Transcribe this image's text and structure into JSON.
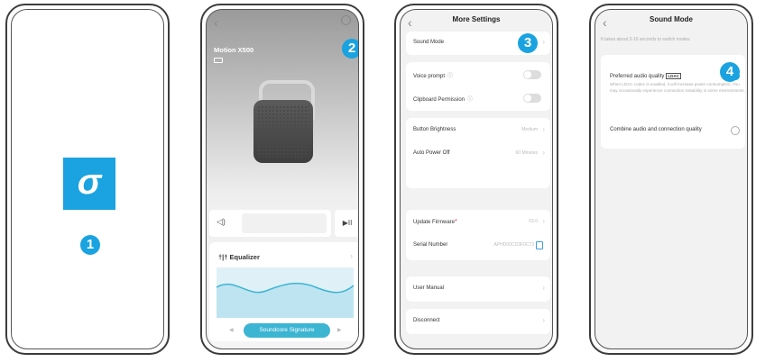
{
  "steps": [
    "1",
    "2",
    "3",
    "4"
  ],
  "phone1": {
    "logo_glyph": "σ"
  },
  "phone2": {
    "back_glyph": "‹",
    "device_name": "Motion X500",
    "volume_icon": "◁)",
    "play_pause_glyph": "▶II",
    "equalizer_icon": "†|†",
    "equalizer_label": "Equalizer",
    "preset_label": "Soundcore Signature",
    "prev_glyph": "◀",
    "next_glyph": "▶"
  },
  "phone3": {
    "title": "More Settings",
    "rows": {
      "sound_mode": "Sound Mode",
      "voice_prompt": "Voice prompt",
      "clipboard_permission": "Clipboard Permission",
      "button_brightness": "Button Brightness",
      "button_brightness_value": "Medium",
      "auto_power_off": "Auto Power Off",
      "auto_power_off_value": "60 Minutes",
      "update_firmware": "Update Firmware",
      "firmware_value": "03.0",
      "serial_number": "Serial Number",
      "serial_value": "APHD00CD3F0C73",
      "user_manual": "User Manual",
      "disconnect": "Disconnect"
    },
    "info_glyph": "ⓘ",
    "chevron": "›"
  },
  "phone4": {
    "title": "Sound Mode",
    "hint": "It takes about 3-10 seconds to switch modes",
    "option1_label": "Preferred audio quality",
    "ldac_badge": "LDAC",
    "option1_desc": "When LDAC codec is enabled, it will increase power consumption. You may occasionally experience connection instability in some environments.",
    "option2_label": "Combine audio and connection quality",
    "check_glyph": "✓"
  },
  "colors": {
    "accent": "#1aa3e0",
    "eq_pill": "#3cb5d3"
  }
}
